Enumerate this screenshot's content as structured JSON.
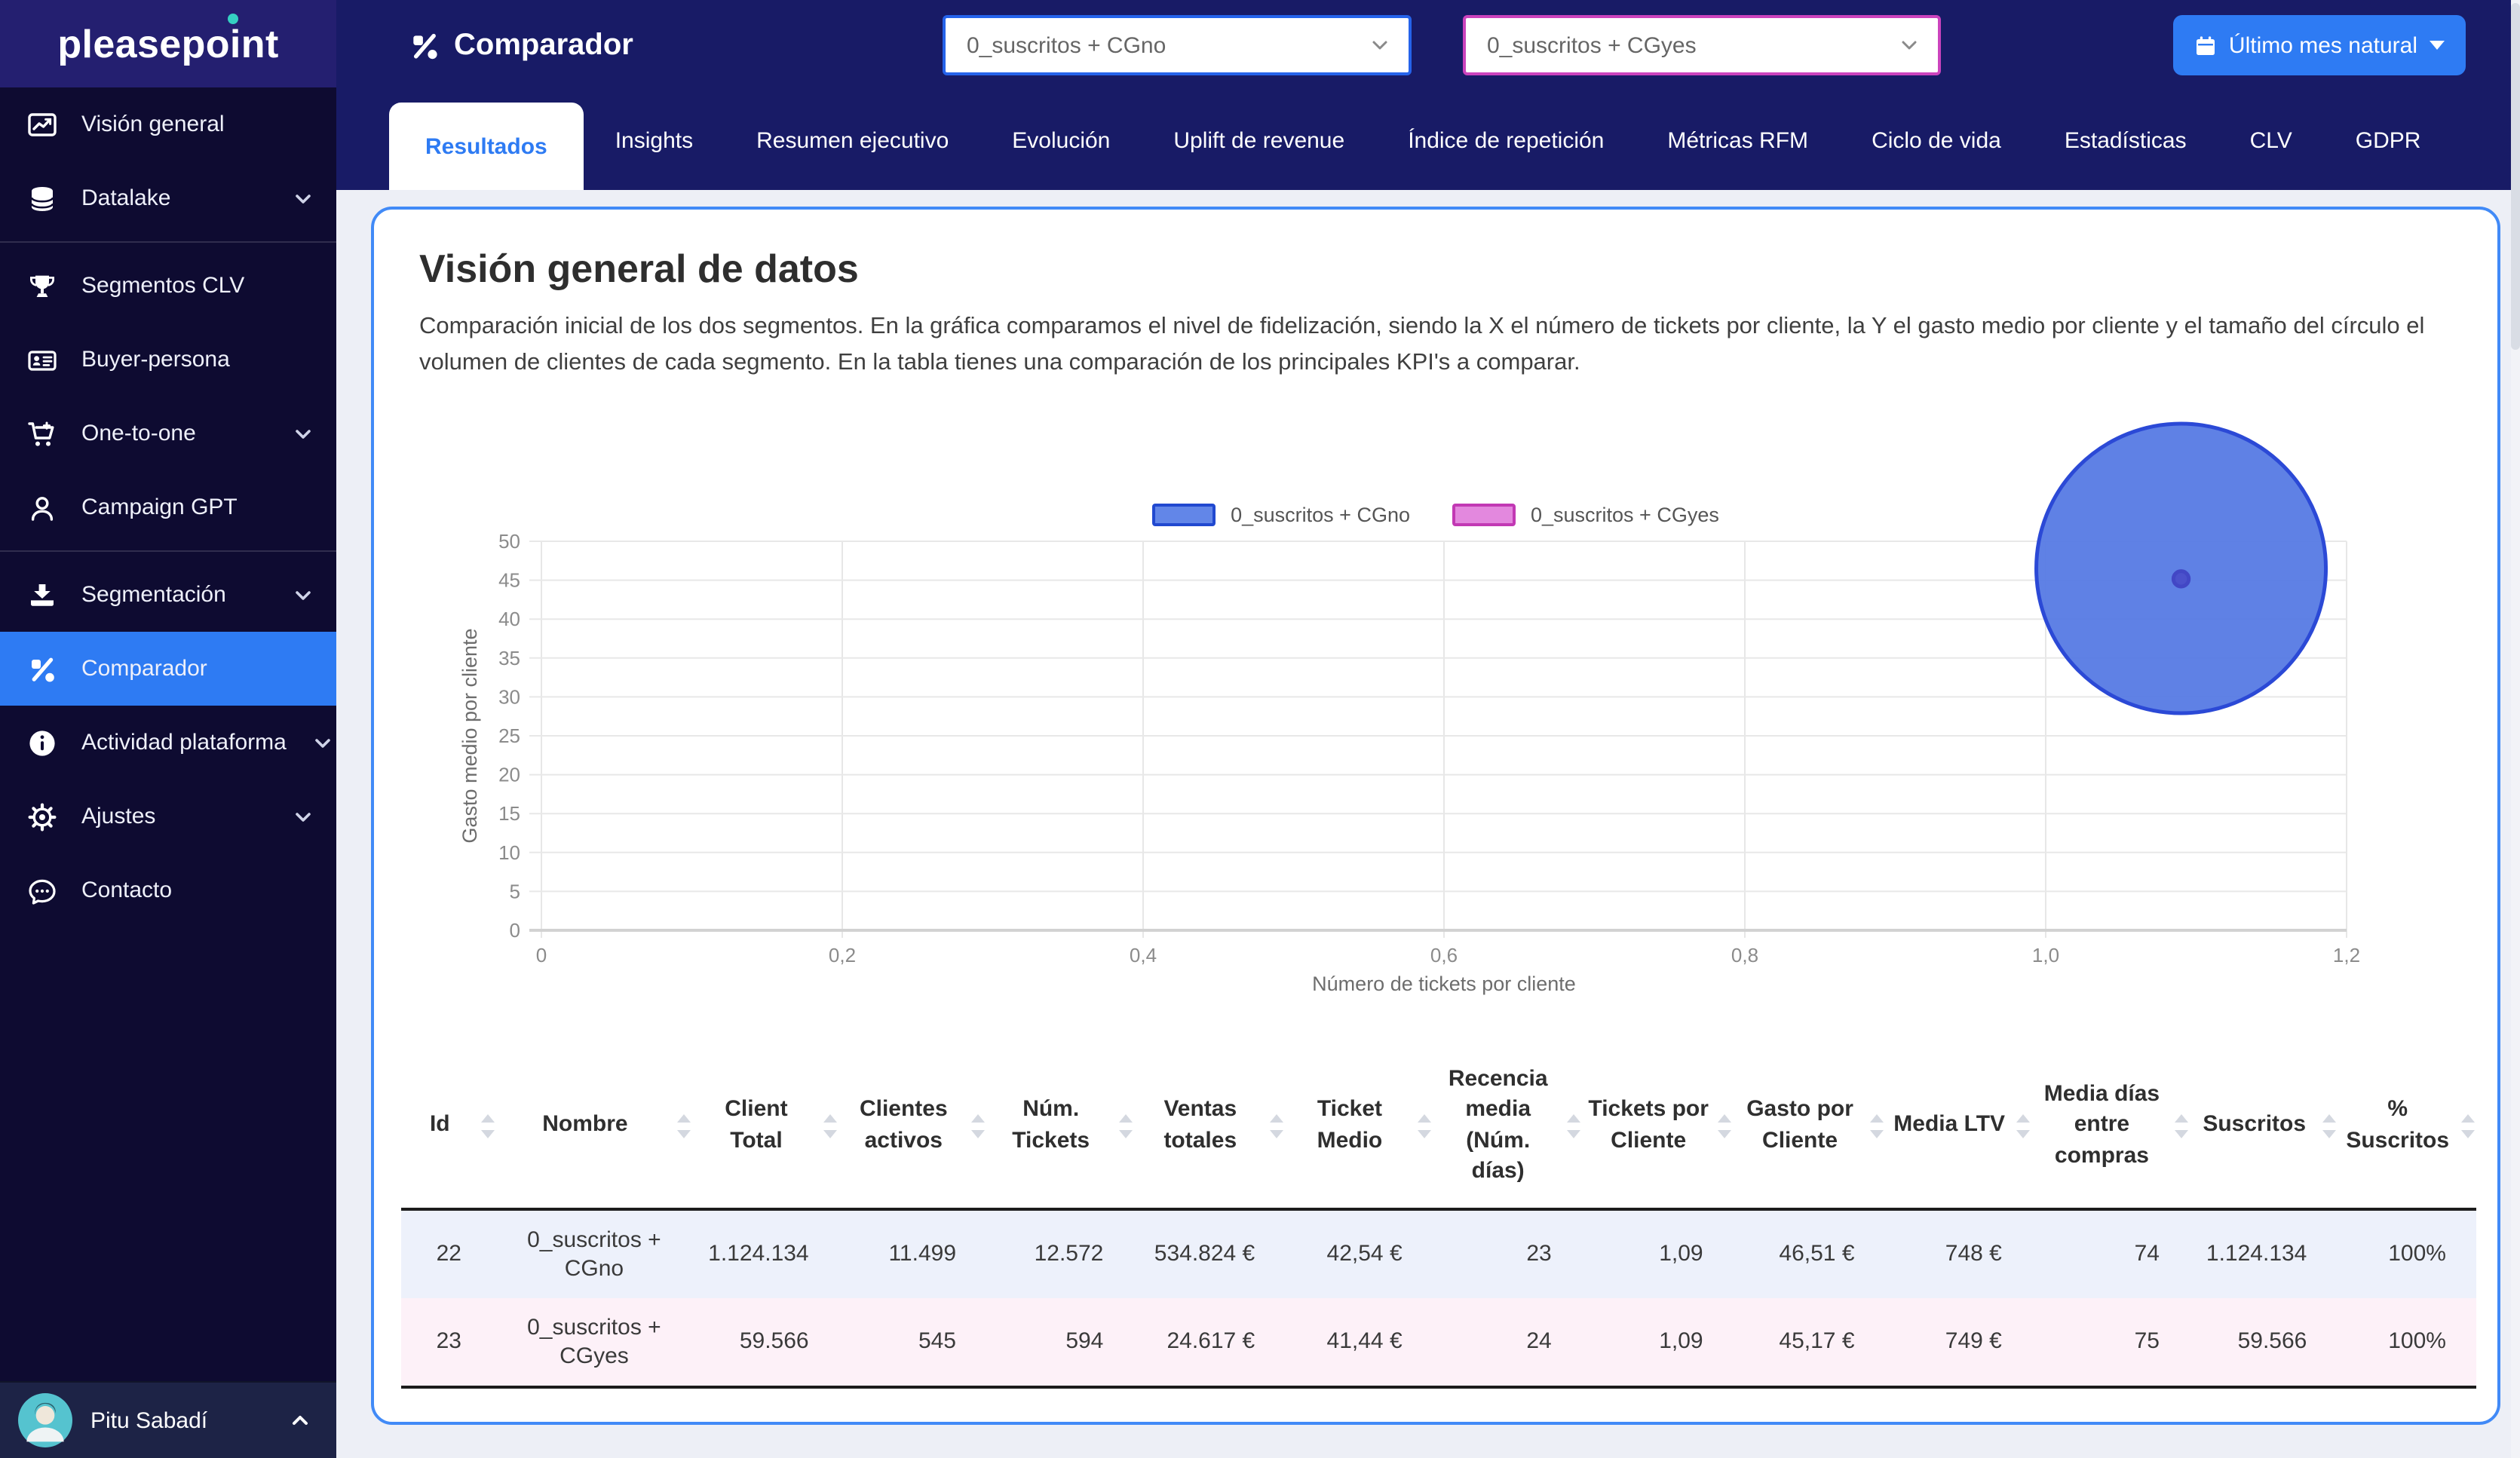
{
  "app": {
    "logo_text": "pleasepoint",
    "accent_color": "#2e7bf3"
  },
  "sidebar": {
    "items": [
      {
        "label": "Visión general",
        "icon": "chart-line-icon",
        "chevron": false,
        "active": false
      },
      {
        "label": "Datalake",
        "icon": "database-icon",
        "chevron": true,
        "active": false
      },
      {
        "label": "Segmentos CLV",
        "icon": "trophy-icon",
        "chevron": false,
        "active": false
      },
      {
        "label": "Buyer-persona",
        "icon": "id-card-icon",
        "chevron": false,
        "active": false
      },
      {
        "label": "One-to-one",
        "icon": "cart-icon",
        "chevron": true,
        "active": false
      },
      {
        "label": "Campaign GPT",
        "icon": "user-icon",
        "chevron": false,
        "active": false
      },
      {
        "label": "Segmentación",
        "icon": "download-icon",
        "chevron": true,
        "active": false
      },
      {
        "label": "Comparador",
        "icon": "percent-icon",
        "chevron": false,
        "active": true
      },
      {
        "label": "Actividad plataforma",
        "icon": "info-icon",
        "chevron": true,
        "active": false
      },
      {
        "label": "Ajustes",
        "icon": "gear-icon",
        "chevron": true,
        "active": false
      },
      {
        "label": "Contacto",
        "icon": "chat-icon",
        "chevron": false,
        "active": false
      }
    ],
    "user": {
      "name": "Pitu Sabadí"
    }
  },
  "header": {
    "title": "Comparador",
    "segment_select_1": {
      "value": "0_suscritos + CGno",
      "accent": "#2563ea"
    },
    "segment_select_2": {
      "value": "0_suscritos + CGyes",
      "accent": "#cb43bd"
    },
    "period_button": "Último mes natural"
  },
  "tabs": [
    "Resultados",
    "Insights",
    "Resumen ejecutivo",
    "Evolución",
    "Uplift de revenue",
    "Índice de repetición",
    "Métricas RFM",
    "Ciclo de vida",
    "Estadísticas",
    "CLV",
    "GDPR"
  ],
  "content": {
    "title": "Visión general de datos",
    "description": "Comparación inicial de los dos segmentos. En la gráfica comparamos el nivel de fidelización, siendo la X el número de tickets por cliente, la Y el gasto medio por cliente y el tamaño del círculo el volumen de clientes de cada segmento. En la tabla tienes una comparación de los principales KPI's a comparar."
  },
  "chart_data": {
    "type": "scatter",
    "subtype": "bubble",
    "xlabel": "Número de tickets por cliente",
    "ylabel": "Gasto medio por cliente",
    "xlim": [
      0,
      1.2
    ],
    "ylim": [
      0,
      50
    ],
    "xticks": [
      "0",
      "0,2",
      "0,4",
      "0,6",
      "0,8",
      "1,0",
      "1,2"
    ],
    "yticks": [
      "0",
      "5",
      "10",
      "15",
      "20",
      "25",
      "30",
      "35",
      "40",
      "45",
      "50"
    ],
    "grid": true,
    "legend_position": "top",
    "series": [
      {
        "name": "0_suscritos + CGno",
        "x": 1.09,
        "y": 46.51,
        "size": 1124134,
        "fill": "#567ae4",
        "stroke": "#2b49d6",
        "fill_opacity": 0.95,
        "legend_fill": "#6286e8",
        "legend_stroke": "#2149d0"
      },
      {
        "name": "0_suscritos + CGyes",
        "x": 1.09,
        "y": 45.17,
        "size": 59566,
        "fill": "#4b51cb",
        "stroke": "#4247c5",
        "fill_opacity": 1,
        "legend_fill": "#e388de",
        "legend_stroke": "#c239b4"
      }
    ]
  },
  "table": {
    "columns": [
      "Id",
      "Nombre",
      "Client Total",
      "Clientes activos",
      "Núm. Tickets",
      "Ventas totales",
      "Ticket Medio",
      "Recencia media (Núm. días)",
      "Tickets por Cliente",
      "Gasto por Cliente",
      "Media LTV",
      "Media días entre compras",
      "Suscritos",
      "% Suscritos"
    ],
    "rows": [
      {
        "cells": [
          "22",
          "0_suscritos + CGno",
          "1.124.134",
          "11.499",
          "12.572",
          "534.824 €",
          "42,54 €",
          "23",
          "1,09",
          "46,51 €",
          "748 €",
          "74",
          "1.124.134",
          "100%"
        ]
      },
      {
        "cells": [
          "23",
          "0_suscritos + CGyes",
          "59.566",
          "545",
          "594",
          "24.617 €",
          "41,44 €",
          "24",
          "1,09",
          "45,17 €",
          "749 €",
          "75",
          "59.566",
          "100%"
        ]
      }
    ]
  }
}
